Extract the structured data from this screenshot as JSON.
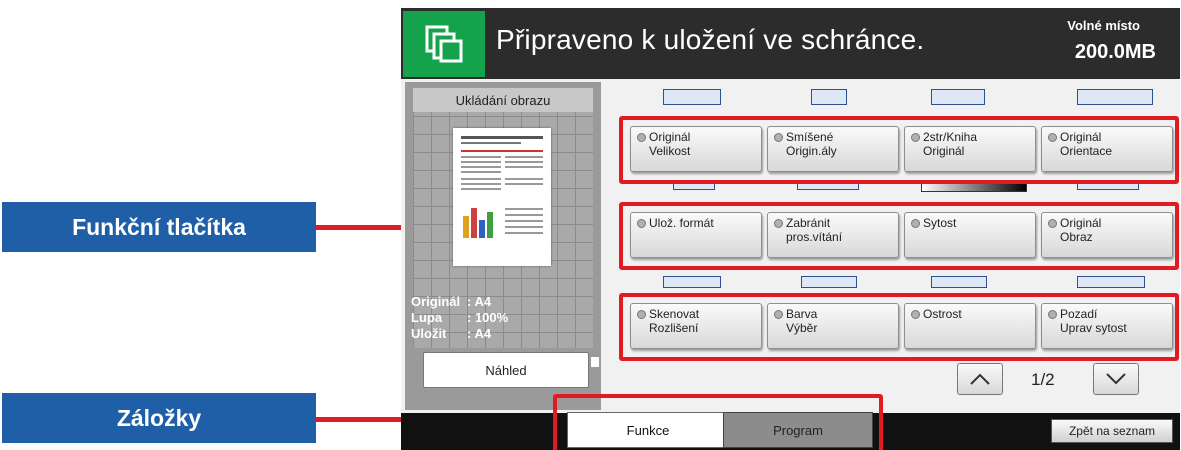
{
  "callouts": {
    "function_buttons": "Funkční tlačítka",
    "tabs": "Záložky"
  },
  "header": {
    "title": "Připraveno k uložení ve schránce.",
    "free_label": "Volné místo",
    "free_value": "200.0MB",
    "icon": "copy-pages-icon"
  },
  "preview": {
    "title": "Ukládání obrazu",
    "info": [
      {
        "key": "Originál",
        "value": ": A4"
      },
      {
        "key": "Lupa",
        "value": ": 100%"
      },
      {
        "key": "Uložit",
        "value": ": A4"
      }
    ],
    "button": "Náhled"
  },
  "function_rows": [
    {
      "buttons": [
        "Originál\nVelikost",
        "Smíšené\nOrigin.ály",
        "2str/Kniha\nOriginál",
        "Originál\nOrientace"
      ]
    },
    {
      "buttons": [
        "Ulož. formát",
        "Zabránit\npros.vítání",
        "Sytost",
        "Originál\nObraz"
      ]
    },
    {
      "buttons": [
        "Skenovat\nRozlišení",
        "Barva\nVýběr",
        "Ostrost",
        "Pozadí\nUprav sytost"
      ]
    }
  ],
  "pager": {
    "page": "1/2"
  },
  "tabs": {
    "functions": "Funkce",
    "program": "Program"
  },
  "back_button": "Zpět na seznam",
  "colors": {
    "accent_green": "#14a24d",
    "highlight_red": "#e11b22",
    "callout_blue": "#1f5fa8"
  }
}
